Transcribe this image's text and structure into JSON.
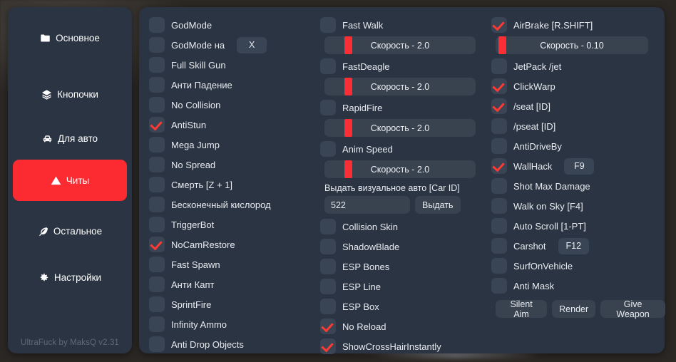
{
  "sidebar": {
    "items": [
      {
        "label": "Основное",
        "icon": "folder-icon",
        "active": false
      },
      {
        "label": "Кнопочки",
        "icon": "layers-icon",
        "active": false
      },
      {
        "label": "Для авто",
        "icon": "car-icon",
        "active": false
      },
      {
        "label": "Читы",
        "icon": "warning-icon",
        "active": true
      },
      {
        "label": "Остальное",
        "icon": "feather-icon",
        "active": false
      },
      {
        "label": "Настройки",
        "icon": "gear-icon",
        "active": false
      }
    ],
    "version": "UltraFuck by MaksQ v2.31",
    "active_color": "#fc2b32"
  },
  "columns": {
    "col1": [
      {
        "type": "checkbox",
        "label": "GodMode",
        "checked": false
      },
      {
        "type": "checkbox",
        "label": "GodMode на",
        "checked": false,
        "keybind": "X"
      },
      {
        "type": "checkbox",
        "label": "Full Skill Gun",
        "checked": false
      },
      {
        "type": "checkbox",
        "label": "Анти Падение",
        "checked": false
      },
      {
        "type": "checkbox",
        "label": "No Collision",
        "checked": false
      },
      {
        "type": "checkbox",
        "label": "AntiStun",
        "checked": true
      },
      {
        "type": "checkbox",
        "label": "Mega Jump",
        "checked": false
      },
      {
        "type": "checkbox",
        "label": "No Spread",
        "checked": false
      },
      {
        "type": "checkbox",
        "label": "Смерть [Z + 1]",
        "checked": false
      },
      {
        "type": "checkbox",
        "label": "Бесконечный кислород",
        "checked": false
      },
      {
        "type": "checkbox",
        "label": "TriggerBot",
        "checked": false
      },
      {
        "type": "checkbox",
        "label": "NoCamRestore",
        "checked": true
      },
      {
        "type": "checkbox",
        "label": "Fast Spawn",
        "checked": false
      },
      {
        "type": "checkbox",
        "label": "Анти Капт",
        "checked": false
      },
      {
        "type": "checkbox",
        "label": "SprintFire",
        "checked": false
      },
      {
        "type": "checkbox",
        "label": "Infinity Ammo",
        "checked": false
      },
      {
        "type": "checkbox",
        "label": "Anti Drop Objects",
        "checked": false
      }
    ],
    "col2": [
      {
        "type": "checkbox",
        "label": "Fast Walk",
        "checked": false
      },
      {
        "type": "slider",
        "label": "Скорость - 2.0",
        "value": 2.0,
        "fill": 13
      },
      {
        "type": "checkbox",
        "label": "FastDeagle",
        "checked": false
      },
      {
        "type": "slider",
        "label": "Скорость - 2.0",
        "value": 2.0,
        "fill": 13
      },
      {
        "type": "checkbox",
        "label": "RapidFire",
        "checked": false
      },
      {
        "type": "slider",
        "label": "Скорость - 2.0",
        "value": 2.0,
        "fill": 13
      },
      {
        "type": "checkbox",
        "label": "Anim Speed",
        "checked": false
      },
      {
        "type": "slider",
        "label": "Скорость - 2.0",
        "value": 2.0,
        "fill": 13
      },
      {
        "type": "label",
        "label": "Выдать визуальное авто [Car ID]"
      },
      {
        "type": "input",
        "value": "522",
        "placeholder": "",
        "button": "Выдать"
      },
      {
        "type": "checkbox",
        "label": "Collision Skin",
        "checked": false
      },
      {
        "type": "checkbox",
        "label": "ShadowBlade",
        "checked": false
      },
      {
        "type": "checkbox",
        "label": "ESP Bones",
        "checked": false
      },
      {
        "type": "checkbox",
        "label": "ESP Line",
        "checked": false
      },
      {
        "type": "checkbox",
        "label": "ESP Box",
        "checked": false
      },
      {
        "type": "checkbox",
        "label": "No Reload",
        "checked": true
      },
      {
        "type": "checkbox",
        "label": "ShowCrossHairInstantly",
        "checked": true
      }
    ],
    "col3": [
      {
        "type": "checkbox",
        "label": "AirBrake [R.SHIFT]",
        "checked": true
      },
      {
        "type": "slider",
        "label": "Скорость - 0.10",
        "value": 0.1,
        "fill": 2
      },
      {
        "type": "checkbox",
        "label": "JetPack /jet",
        "checked": false
      },
      {
        "type": "checkbox",
        "label": "ClickWarp",
        "checked": true
      },
      {
        "type": "checkbox",
        "label": "/seat [ID]",
        "checked": true
      },
      {
        "type": "checkbox",
        "label": "/pseat [ID]",
        "checked": false
      },
      {
        "type": "checkbox",
        "label": "AntiDriveBy",
        "checked": false
      },
      {
        "type": "checkbox",
        "label": "WallHack",
        "checked": true,
        "keybind": "F9"
      },
      {
        "type": "checkbox",
        "label": "Shot Max Damage",
        "checked": false
      },
      {
        "type": "checkbox",
        "label": "Walk on Sky [F4]",
        "checked": false
      },
      {
        "type": "checkbox",
        "label": "Auto Scroll [1-PT]",
        "checked": false
      },
      {
        "type": "checkbox",
        "label": "Carshot",
        "checked": false,
        "keybind": "F12"
      },
      {
        "type": "checkbox",
        "label": "SurfOnVehicle",
        "checked": false
      },
      {
        "type": "checkbox",
        "label": "Anti Mask",
        "checked": false
      },
      {
        "type": "buttons",
        "buttons": [
          "Silent Aim",
          "Render",
          "Give Weapon"
        ]
      }
    ]
  },
  "theme": {
    "panel_bg": "#2b3442",
    "control_bg": "#394454",
    "accent": "#fb3a33",
    "text": "#e8ecf1"
  }
}
